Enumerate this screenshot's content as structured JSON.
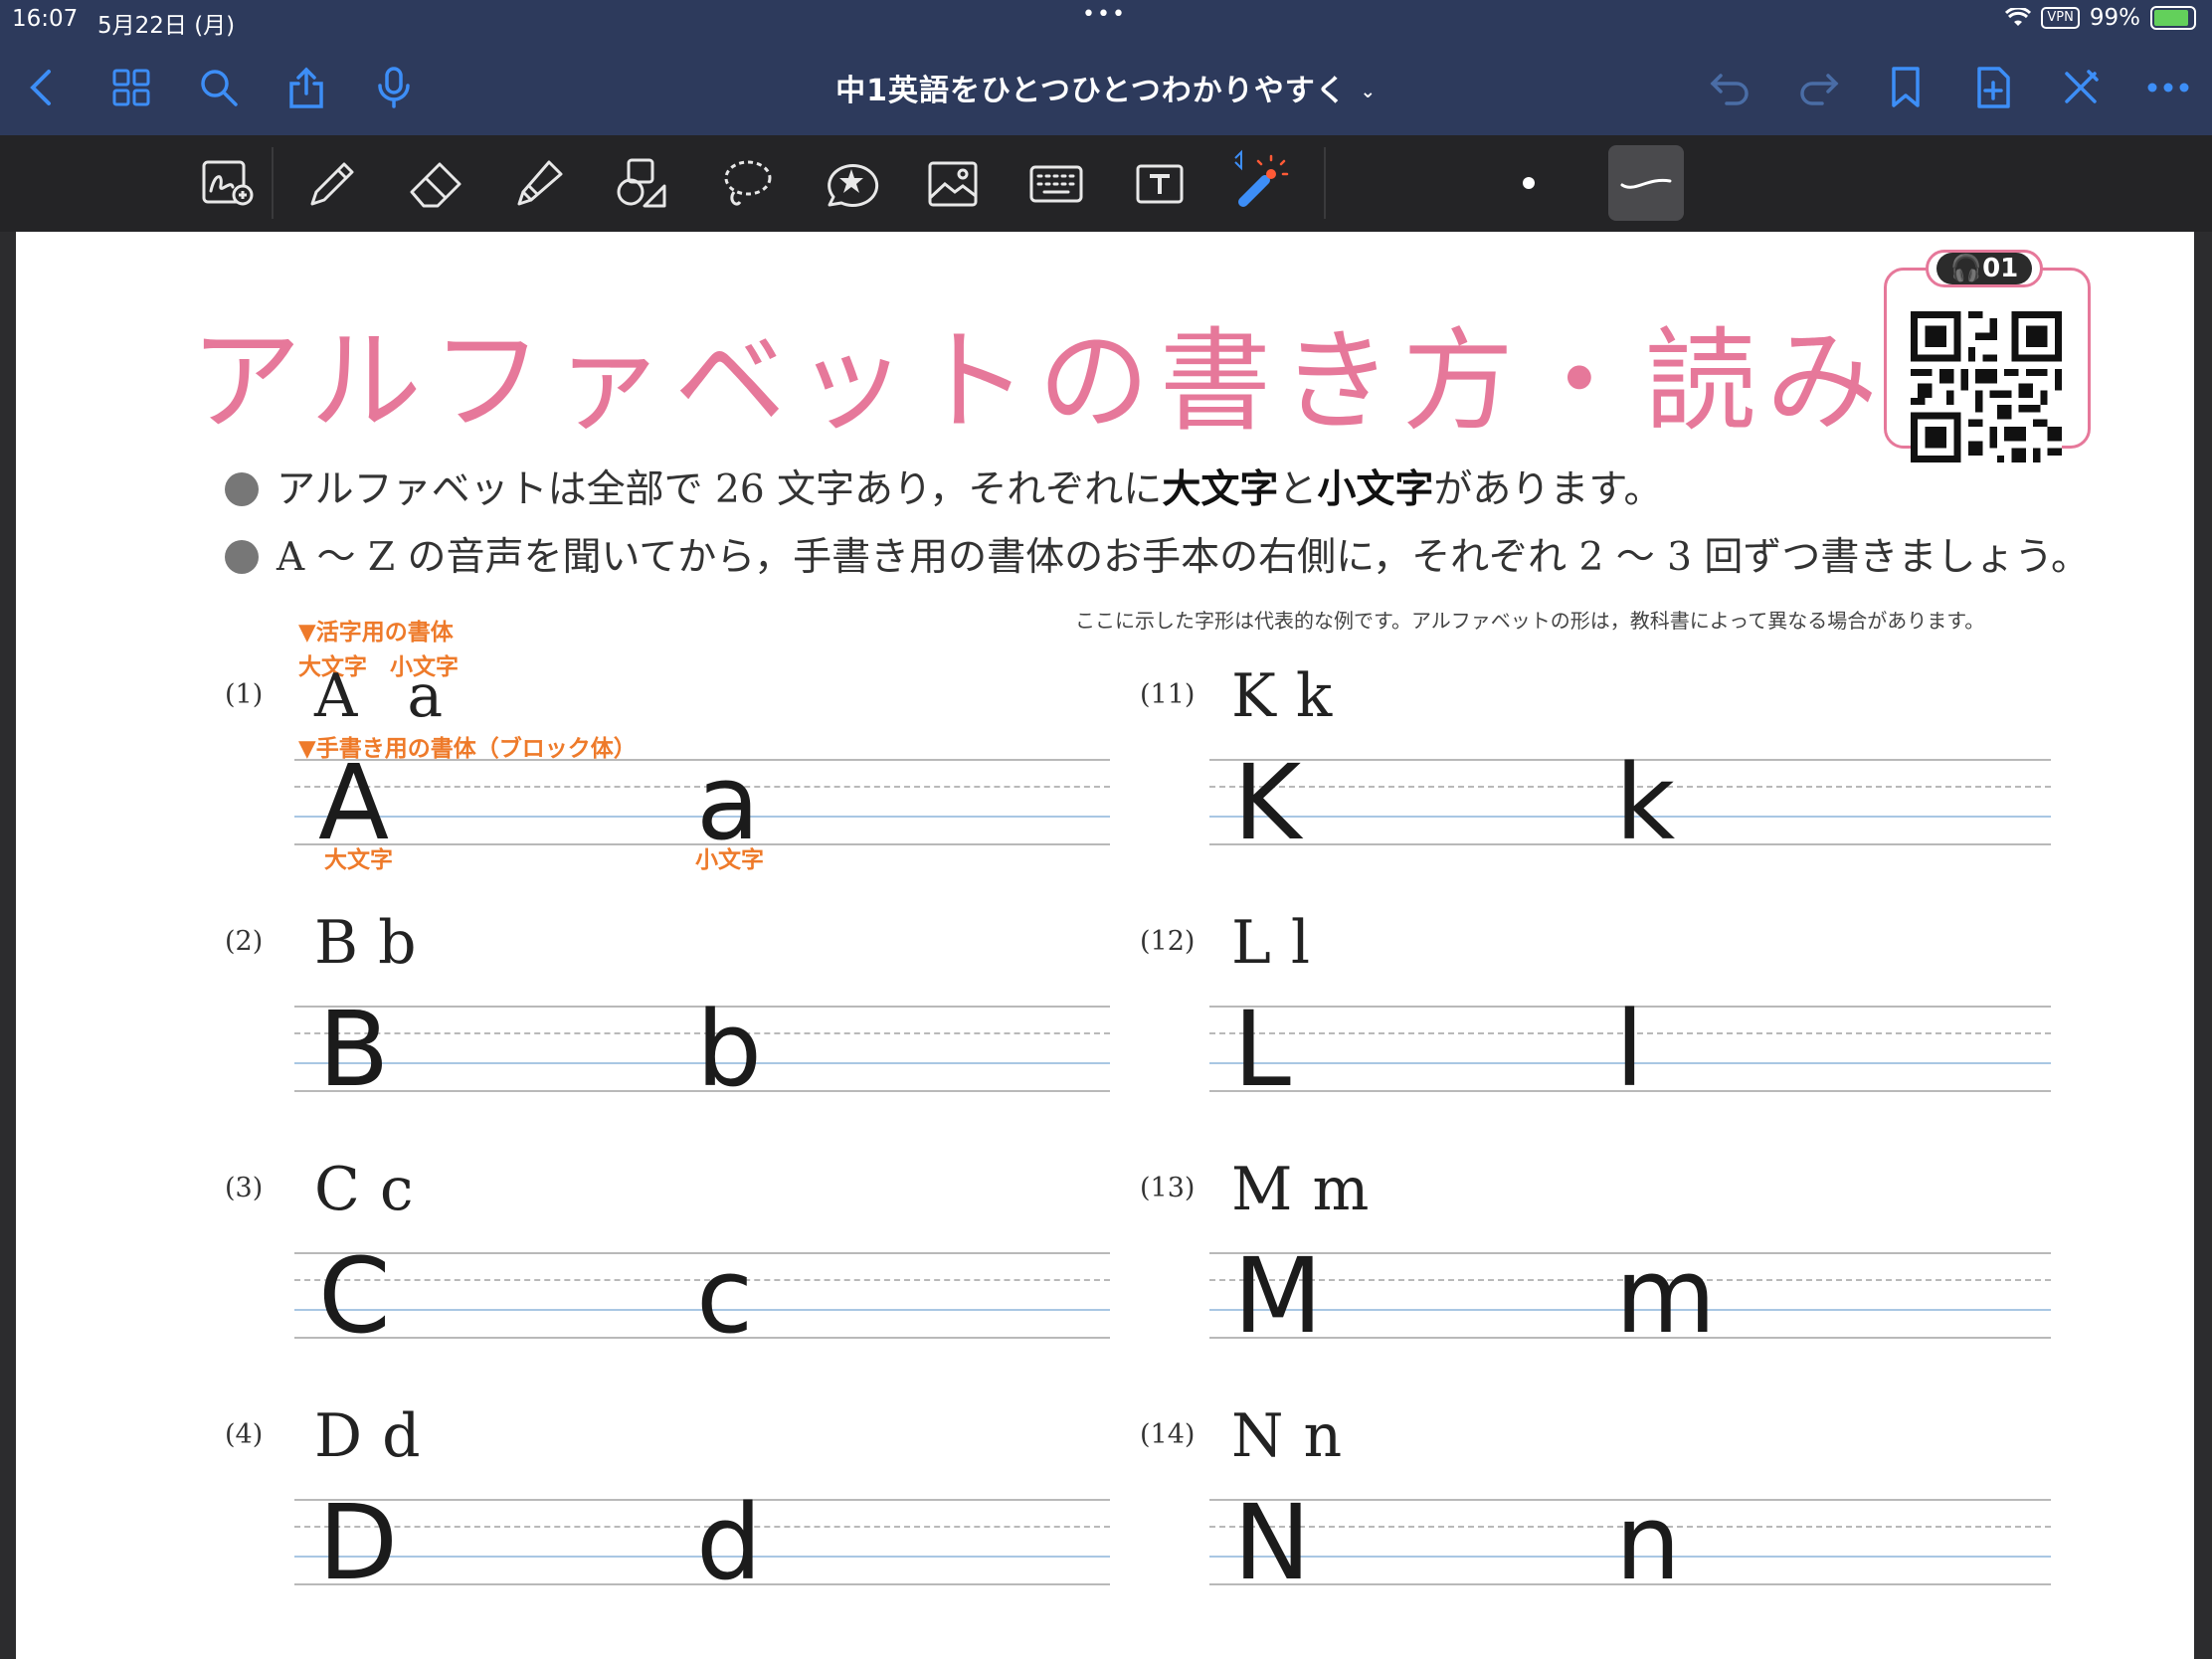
{
  "status_bar": {
    "time": "16:07",
    "date": "5月22日 (月)",
    "dots": "•••",
    "vpn": "VPN",
    "battery": "99%"
  },
  "nav": {
    "title": "中1英語をひとつひとつわかりやすく",
    "icons": [
      "back-icon",
      "grid-icon",
      "search-icon",
      "share-icon",
      "microphone-icon",
      "undo-icon",
      "redo-icon",
      "bookmark-icon",
      "add-page-icon",
      "close-pen-icon",
      "more-icon"
    ]
  },
  "tools": [
    "zoom-window-icon",
    "pen-icon",
    "eraser-icon",
    "highlighter-icon",
    "shapes-icon",
    "lasso-icon",
    "elements-icon",
    "image-icon",
    "keyboard-icon",
    "textbox-icon",
    "laser-pointer-icon"
  ],
  "page": {
    "title": "アルファベットの書き方・読み方",
    "qr_badge": "01",
    "bullet1": {
      "pre": "アルファベットは全部で 26 文字あり，それぞれに",
      "b1": "大文字",
      "mid": "と",
      "b2": "小文字",
      "post": "があります。"
    },
    "bullet2": "A ～ Z の音声を聞いてから，手書き用の書体のお手本の右側に，それぞれ 2 ～ 3 回ずつ書きましょう。",
    "note": "ここに示した字形は代表的な例です。アルファベットの形は，教科書によって異なる場合があります。",
    "label_print": "▼活字用の書体",
    "label_cases": "大文字　小文字",
    "label_block": "▼手書き用の書体（ブロック体）",
    "label_upper": "大文字",
    "label_lower": "小文字",
    "letters_left": [
      {
        "num": "(1)",
        "upper": "A",
        "lower": "a"
      },
      {
        "num": "(2)",
        "upper": "B",
        "lower": "b"
      },
      {
        "num": "(3)",
        "upper": "C",
        "lower": "c"
      },
      {
        "num": "(4)",
        "upper": "D",
        "lower": "d"
      }
    ],
    "letters_right": [
      {
        "num": "(11)",
        "upper": "K",
        "lower": "k"
      },
      {
        "num": "(12)",
        "upper": "L",
        "lower": "l"
      },
      {
        "num": "(13)",
        "upper": "M",
        "lower": "m"
      },
      {
        "num": "(14)",
        "upper": "N",
        "lower": "n"
      }
    ]
  }
}
